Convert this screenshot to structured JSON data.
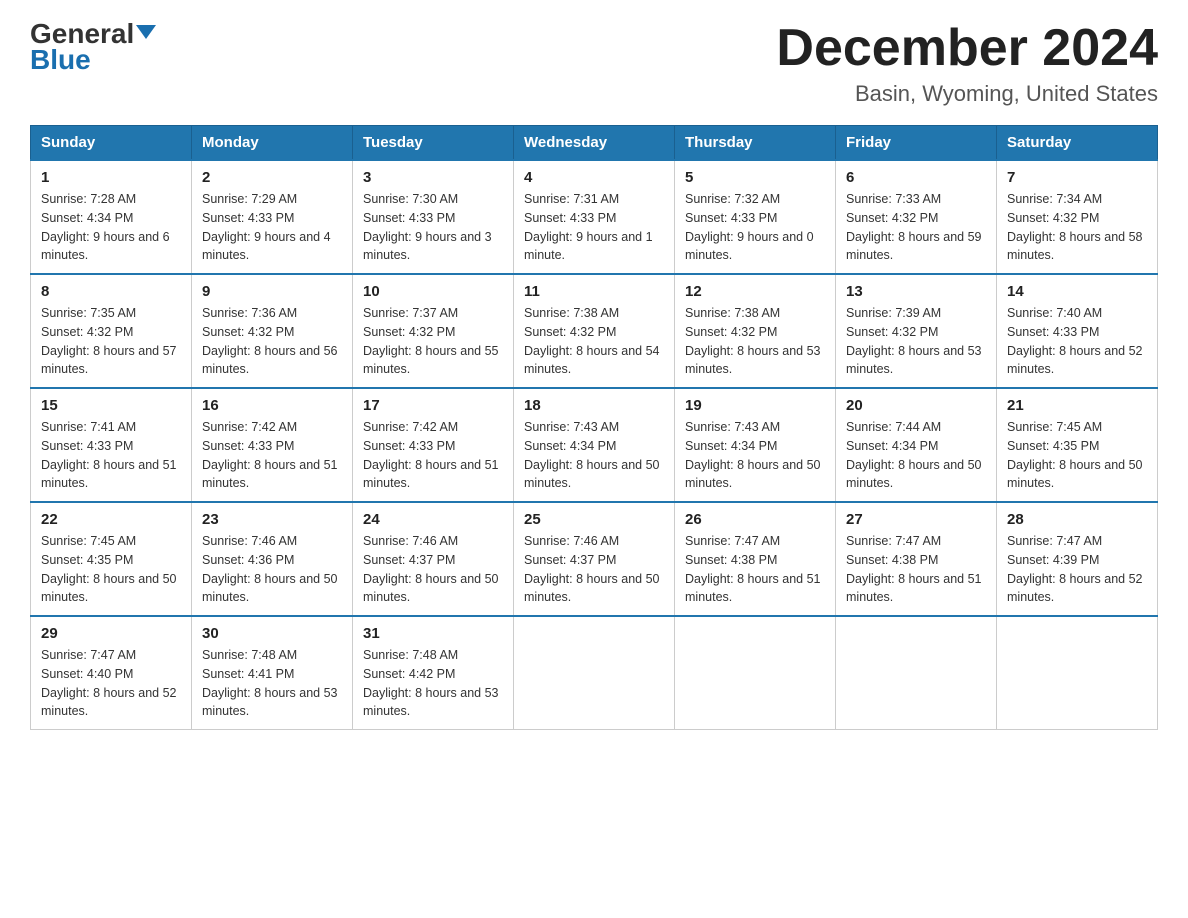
{
  "logo": {
    "general": "General",
    "triangle": "▲",
    "blue": "Blue"
  },
  "header": {
    "month_year": "December 2024",
    "location": "Basin, Wyoming, United States"
  },
  "days_of_week": [
    "Sunday",
    "Monday",
    "Tuesday",
    "Wednesday",
    "Thursday",
    "Friday",
    "Saturday"
  ],
  "weeks": [
    [
      {
        "day": "1",
        "sunrise": "7:28 AM",
        "sunset": "4:34 PM",
        "daylight": "9 hours and 6 minutes."
      },
      {
        "day": "2",
        "sunrise": "7:29 AM",
        "sunset": "4:33 PM",
        "daylight": "9 hours and 4 minutes."
      },
      {
        "day": "3",
        "sunrise": "7:30 AM",
        "sunset": "4:33 PM",
        "daylight": "9 hours and 3 minutes."
      },
      {
        "day": "4",
        "sunrise": "7:31 AM",
        "sunset": "4:33 PM",
        "daylight": "9 hours and 1 minute."
      },
      {
        "day": "5",
        "sunrise": "7:32 AM",
        "sunset": "4:33 PM",
        "daylight": "9 hours and 0 minutes."
      },
      {
        "day": "6",
        "sunrise": "7:33 AM",
        "sunset": "4:32 PM",
        "daylight": "8 hours and 59 minutes."
      },
      {
        "day": "7",
        "sunrise": "7:34 AM",
        "sunset": "4:32 PM",
        "daylight": "8 hours and 58 minutes."
      }
    ],
    [
      {
        "day": "8",
        "sunrise": "7:35 AM",
        "sunset": "4:32 PM",
        "daylight": "8 hours and 57 minutes."
      },
      {
        "day": "9",
        "sunrise": "7:36 AM",
        "sunset": "4:32 PM",
        "daylight": "8 hours and 56 minutes."
      },
      {
        "day": "10",
        "sunrise": "7:37 AM",
        "sunset": "4:32 PM",
        "daylight": "8 hours and 55 minutes."
      },
      {
        "day": "11",
        "sunrise": "7:38 AM",
        "sunset": "4:32 PM",
        "daylight": "8 hours and 54 minutes."
      },
      {
        "day": "12",
        "sunrise": "7:38 AM",
        "sunset": "4:32 PM",
        "daylight": "8 hours and 53 minutes."
      },
      {
        "day": "13",
        "sunrise": "7:39 AM",
        "sunset": "4:32 PM",
        "daylight": "8 hours and 53 minutes."
      },
      {
        "day": "14",
        "sunrise": "7:40 AM",
        "sunset": "4:33 PM",
        "daylight": "8 hours and 52 minutes."
      }
    ],
    [
      {
        "day": "15",
        "sunrise": "7:41 AM",
        "sunset": "4:33 PM",
        "daylight": "8 hours and 51 minutes."
      },
      {
        "day": "16",
        "sunrise": "7:42 AM",
        "sunset": "4:33 PM",
        "daylight": "8 hours and 51 minutes."
      },
      {
        "day": "17",
        "sunrise": "7:42 AM",
        "sunset": "4:33 PM",
        "daylight": "8 hours and 51 minutes."
      },
      {
        "day": "18",
        "sunrise": "7:43 AM",
        "sunset": "4:34 PM",
        "daylight": "8 hours and 50 minutes."
      },
      {
        "day": "19",
        "sunrise": "7:43 AM",
        "sunset": "4:34 PM",
        "daylight": "8 hours and 50 minutes."
      },
      {
        "day": "20",
        "sunrise": "7:44 AM",
        "sunset": "4:34 PM",
        "daylight": "8 hours and 50 minutes."
      },
      {
        "day": "21",
        "sunrise": "7:45 AM",
        "sunset": "4:35 PM",
        "daylight": "8 hours and 50 minutes."
      }
    ],
    [
      {
        "day": "22",
        "sunrise": "7:45 AM",
        "sunset": "4:35 PM",
        "daylight": "8 hours and 50 minutes."
      },
      {
        "day": "23",
        "sunrise": "7:46 AM",
        "sunset": "4:36 PM",
        "daylight": "8 hours and 50 minutes."
      },
      {
        "day": "24",
        "sunrise": "7:46 AM",
        "sunset": "4:37 PM",
        "daylight": "8 hours and 50 minutes."
      },
      {
        "day": "25",
        "sunrise": "7:46 AM",
        "sunset": "4:37 PM",
        "daylight": "8 hours and 50 minutes."
      },
      {
        "day": "26",
        "sunrise": "7:47 AM",
        "sunset": "4:38 PM",
        "daylight": "8 hours and 51 minutes."
      },
      {
        "day": "27",
        "sunrise": "7:47 AM",
        "sunset": "4:38 PM",
        "daylight": "8 hours and 51 minutes."
      },
      {
        "day": "28",
        "sunrise": "7:47 AM",
        "sunset": "4:39 PM",
        "daylight": "8 hours and 52 minutes."
      }
    ],
    [
      {
        "day": "29",
        "sunrise": "7:47 AM",
        "sunset": "4:40 PM",
        "daylight": "8 hours and 52 minutes."
      },
      {
        "day": "30",
        "sunrise": "7:48 AM",
        "sunset": "4:41 PM",
        "daylight": "8 hours and 53 minutes."
      },
      {
        "day": "31",
        "sunrise": "7:48 AM",
        "sunset": "4:42 PM",
        "daylight": "8 hours and 53 minutes."
      },
      null,
      null,
      null,
      null
    ]
  ]
}
